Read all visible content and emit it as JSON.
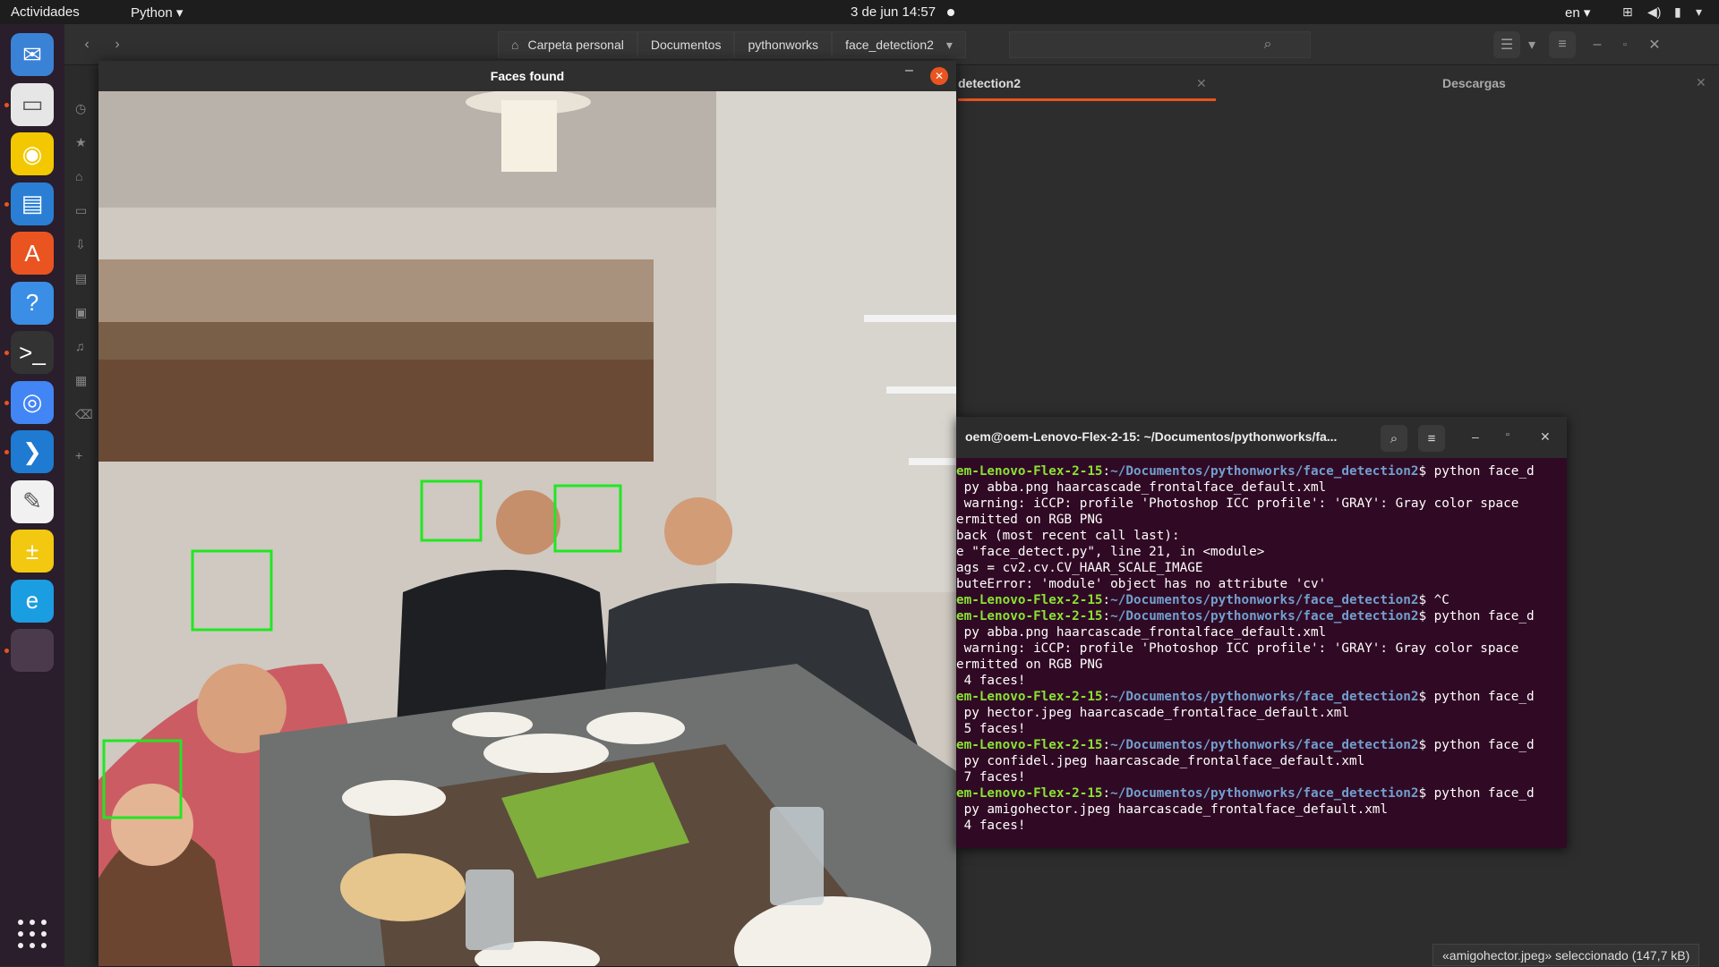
{
  "topbar": {
    "activities": "Actividades",
    "app_menu": "Python ▾",
    "clock": "3 de jun  14:57",
    "lang": "en ▾"
  },
  "dock": {
    "apps": [
      {
        "name": "thunderbird",
        "icon": "mail-icon",
        "color": "#3a82d6",
        "running": false
      },
      {
        "name": "files",
        "icon": "folder-icon",
        "color": "#e6e6e6",
        "running": true
      },
      {
        "name": "rhythmbox",
        "icon": "music-icon",
        "color": "#f3c800",
        "running": false
      },
      {
        "name": "libreoffice-writer",
        "icon": "document-icon",
        "color": "#2a7fd4",
        "running": true
      },
      {
        "name": "software",
        "icon": "store-icon",
        "color": "#e95420",
        "running": false
      },
      {
        "name": "help",
        "icon": "help-icon",
        "color": "#3a8ee6",
        "running": false
      },
      {
        "name": "terminal",
        "icon": "terminal-icon",
        "color": "#333333",
        "running": true
      },
      {
        "name": "chrome",
        "icon": "chrome-icon",
        "color": "#4285f4",
        "running": true
      },
      {
        "name": "vscode",
        "icon": "vscode-icon",
        "color": "#1f7ad1",
        "running": true
      },
      {
        "name": "gimp",
        "icon": "gimp-icon",
        "color": "#f1f1f1",
        "running": false
      },
      {
        "name": "calculator",
        "icon": "calculator-icon",
        "color": "#f2c811",
        "running": false
      },
      {
        "name": "edge",
        "icon": "edge-icon",
        "color": "#1b9de2",
        "running": false
      },
      {
        "name": "python-window",
        "icon": "window-icon",
        "color": "#4a3a4c",
        "running": true
      }
    ]
  },
  "files": {
    "path": [
      "Carpeta personal",
      "Documentos",
      "pythonworks",
      "face_detection2"
    ],
    "tabs": [
      {
        "label": "detection2",
        "active": true
      },
      {
        "label": "Descargas",
        "active": false
      }
    ],
    "status": "«amigohector.jpeg» seleccionado (147,7 kB)"
  },
  "faces_window": {
    "title": "Faces found"
  },
  "terminal": {
    "title": "oem@oem-Lenovo-Flex-2-15: ~/Documentos/pythonworks/fa...",
    "lines": [
      {
        "user": "em-Lenovo-Flex-2-15",
        "path": "~/Documentos/pythonworks/face_detection2",
        "text": "$ python face_d"
      },
      {
        "text": " py abba.png haarcascade_frontalface_default.xml"
      },
      {
        "text": " warning: iCCP: profile 'Photoshop ICC profile': 'GRAY': Gray color space"
      },
      {
        "text": "ermitted on RGB PNG"
      },
      {
        "text": "back (most recent call last):"
      },
      {
        "text": "e \"face_detect.py\", line 21, in <module>"
      },
      {
        "text": "ags = cv2.cv.CV_HAAR_SCALE_IMAGE"
      },
      {
        "text": "buteError: 'module' object has no attribute 'cv'"
      },
      {
        "user": "em-Lenovo-Flex-2-15",
        "path": "~/Documentos/pythonworks/face_detection2",
        "text": "$ ^C"
      },
      {
        "user": "em-Lenovo-Flex-2-15",
        "path": "~/Documentos/pythonworks/face_detection2",
        "text": "$ python face_d"
      },
      {
        "text": " py abba.png haarcascade_frontalface_default.xml"
      },
      {
        "text": " warning: iCCP: profile 'Photoshop ICC profile': 'GRAY': Gray color space"
      },
      {
        "text": "ermitted on RGB PNG"
      },
      {
        "text": " 4 faces!"
      },
      {
        "user": "em-Lenovo-Flex-2-15",
        "path": "~/Documentos/pythonworks/face_detection2",
        "text": "$ python face_d"
      },
      {
        "text": " py hector.jpeg haarcascade_frontalface_default.xml"
      },
      {
        "text": " 5 faces!"
      },
      {
        "user": "em-Lenovo-Flex-2-15",
        "path": "~/Documentos/pythonworks/face_detection2",
        "text": "$ python face_d"
      },
      {
        "text": " py confidel.jpeg haarcascade_frontalface_default.xml"
      },
      {
        "text": " 7 faces!"
      },
      {
        "user": "em-Lenovo-Flex-2-15",
        "path": "~/Documentos/pythonworks/face_detection2",
        "text": "$ python face_d"
      },
      {
        "text": " py amigohector.jpeg haarcascade_frontalface_default.xml"
      },
      {
        "text": " 4 faces!"
      }
    ]
  },
  "colors": {
    "accent": "#e95420",
    "face_box": "#22e622",
    "terminal_bg": "#300a24",
    "prompt_user": "#8ae234",
    "prompt_path": "#729fcf"
  }
}
